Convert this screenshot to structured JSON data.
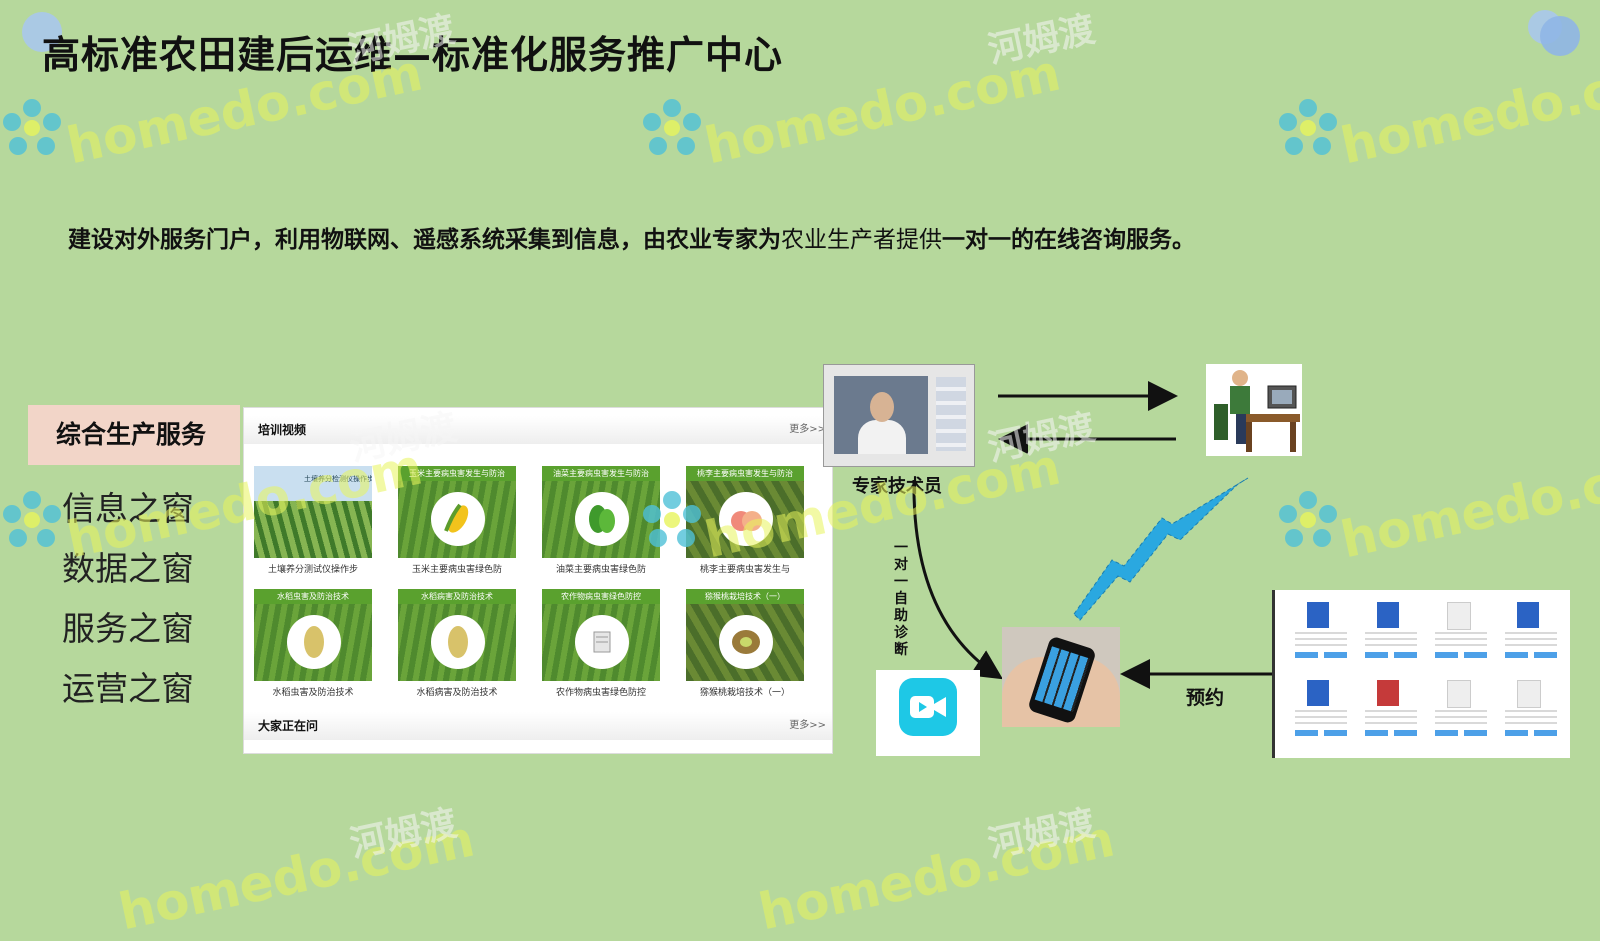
{
  "title": "高标准农田建后运维—标准化服务推广中心",
  "subtitle": {
    "bold_part": "建设对外服务门户，利用物联网、遥感系统采集到信息，由农业专家为",
    "normal_part": "农业生产者提供",
    "bold_end": "一对一的在线咨询服务。"
  },
  "menu": {
    "header": "综合生产服务",
    "items": [
      "信息之窗",
      "数据之窗",
      "服务之窗",
      "运营之窗"
    ]
  },
  "portal": {
    "section_title": "培训视频",
    "section_more": "更多>>",
    "footer_title": "大家正在问",
    "footer_more": "更多>>",
    "field_intro": "土壤养分检测仪操作步骤教学",
    "cards": [
      {
        "banner": "",
        "caption": "土壤养分测试仪操作步"
      },
      {
        "banner": "玉米主要病虫害发生与防治",
        "caption": "玉米主要病虫害绿色防"
      },
      {
        "banner": "油菜主要病虫害发生与防治",
        "caption": "油菜主要病虫害绿色防"
      },
      {
        "banner": "桃李主要病虫害发生与防治",
        "caption": "桃李主要病虫害发生与"
      },
      {
        "banner": "水稻虫害及防治技术",
        "caption": "水稻虫害及防治技术"
      },
      {
        "banner": "水稻病害及防治技术",
        "caption": "水稻病害及防治技术"
      },
      {
        "banner": "农作物病虫害绿色防控",
        "caption": "农作物病虫害绿色防控"
      },
      {
        "banner": "猕猴桃栽培技术（一）",
        "caption": "猕猴桃栽培技术（一）"
      }
    ]
  },
  "diagram": {
    "expert_label": "专家技术员",
    "vertical_label": "一对一自助诊断",
    "appointment_label": "预约"
  },
  "watermark": {
    "en": "homedo.com",
    "cn": "河姆渡"
  },
  "colors": {
    "background": "#b6d89c",
    "menu_header": "#f2d5c8",
    "video_button": "#1ec8e6",
    "signal_blue": "#2aa8e0"
  }
}
